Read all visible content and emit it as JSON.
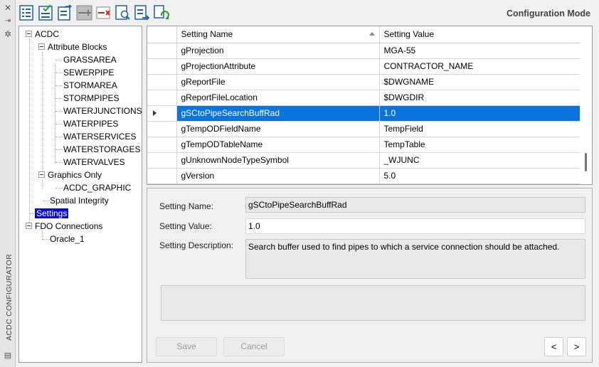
{
  "window": {
    "side_title": "ACDC CONFIGURATOR",
    "mode_label": "Configuration Mode"
  },
  "toolbar": {
    "buttons": [
      "list-icon",
      "checklist-icon",
      "import-icon",
      "add-row-icon",
      "remove-row-icon",
      "search-doc-icon",
      "export-icon",
      "refresh-icon"
    ]
  },
  "tree": {
    "root": "ACDC",
    "attribute_blocks": "Attribute Blocks",
    "blocks": [
      "GRASSAREA",
      "SEWERPIPE",
      "STORMAREA",
      "STORMPIPES",
      "WATERJUNCTIONS",
      "WATERPIPES",
      "WATERSERVICES",
      "WATERSTORAGES",
      "WATERVALVES"
    ],
    "graphics_only": "Graphics Only",
    "graphic": "ACDC_GRAPHIC",
    "spatial_integrity": "Spatial Integrity",
    "settings": "Settings",
    "fdo_connections": "FDO Connections",
    "oracle": "Oracle_1"
  },
  "grid": {
    "col_name": "Setting Name",
    "col_value": "Setting Value",
    "rows": [
      {
        "name": "gProjection",
        "value": "MGA-55"
      },
      {
        "name": "gProjectionAttribute",
        "value": "CONTRACTOR_NAME"
      },
      {
        "name": "gReportFile",
        "value": "$DWGNAME"
      },
      {
        "name": "gReportFileLocation",
        "value": "$DWGDIR"
      },
      {
        "name": "gSCtoPipeSearchBuffRad",
        "value": "1.0"
      },
      {
        "name": "gTempODFieldName",
        "value": "TempField"
      },
      {
        "name": "gTempODTableName",
        "value": "TempTable"
      },
      {
        "name": "gUnknownNodeTypeSymbol",
        "value": "_WJUNC"
      },
      {
        "name": "gVersion",
        "value": "5.0"
      }
    ],
    "selected_index": 4
  },
  "detail": {
    "name_label": "Setting Name:",
    "name_value": "gSCtoPipeSearchBuffRad",
    "value_label": "Setting Value:",
    "value_value": "1.0",
    "desc_label": "Setting Description:",
    "desc_value": "Search buffer used to find pipes to which a service connection should be attached.",
    "save": "Save",
    "cancel": "Cancel",
    "prev": "<",
    "next": ">"
  },
  "colors": {
    "selection": "#0a74da",
    "tree_selection": "#0a0ad8"
  }
}
